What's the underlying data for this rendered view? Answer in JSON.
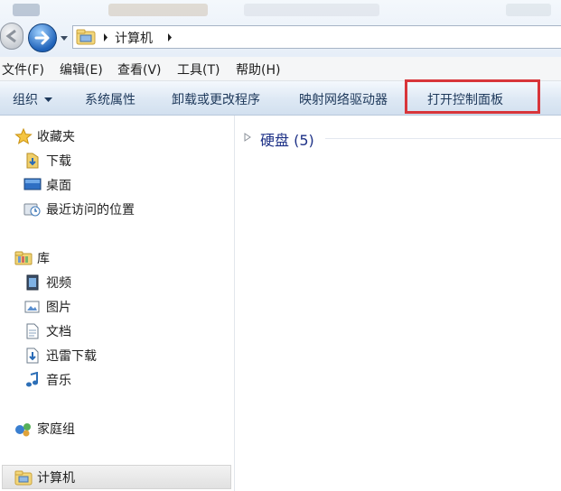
{
  "address_bar": {
    "path": [
      "计算机"
    ]
  },
  "menu_bar": {
    "items": [
      "文件(F)",
      "编辑(E)",
      "查看(V)",
      "工具(T)",
      "帮助(H)"
    ]
  },
  "command_bar": {
    "organize": "组织",
    "system_properties": "系统属性",
    "uninstall_programs": "卸载或更改程序",
    "map_network_drive": "映射网络驱动器",
    "open_control_panel": "打开控制面板"
  },
  "nav_pane": {
    "favorites": {
      "label": "收藏夹",
      "icon": "star-icon",
      "items": [
        {
          "label": "下载",
          "icon": "download-folder-icon"
        },
        {
          "label": "桌面",
          "icon": "desktop-icon"
        },
        {
          "label": "最近访问的位置",
          "icon": "recent-places-icon"
        }
      ]
    },
    "libraries": {
      "label": "库",
      "icon": "library-icon",
      "items": [
        {
          "label": "视频",
          "icon": "video-library-icon"
        },
        {
          "label": "图片",
          "icon": "pictures-library-icon"
        },
        {
          "label": "文档",
          "icon": "documents-library-icon"
        },
        {
          "label": "迅雷下载",
          "icon": "thunder-download-icon"
        },
        {
          "label": "音乐",
          "icon": "music-library-icon"
        }
      ]
    },
    "homegroup": {
      "label": "家庭组",
      "icon": "homegroup-icon"
    },
    "computer": {
      "label": "计算机",
      "icon": "computer-icon",
      "selected": true
    }
  },
  "content": {
    "group_title": "硬盘 (5)"
  },
  "colors": {
    "highlight_border": "#d8353a",
    "command_text": "#1e395b",
    "group_title": "#1e3287"
  }
}
